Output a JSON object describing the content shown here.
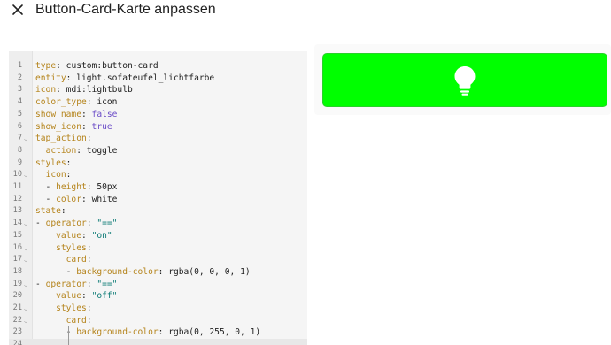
{
  "header": {
    "close_icon": "close-icon",
    "title": "Button-Card-Karte anpassen"
  },
  "editor": {
    "active_line": 24,
    "lines": [
      {
        "n": "1",
        "fold": false,
        "indent": 0,
        "key": "type",
        "sep": ": ",
        "value": "custom:button-card",
        "vtype": "plain"
      },
      {
        "n": "2",
        "fold": false,
        "indent": 0,
        "key": "entity",
        "sep": ": ",
        "value": "light.sofateufel_lichtfarbe",
        "vtype": "plain"
      },
      {
        "n": "3",
        "fold": false,
        "indent": 0,
        "key": "icon",
        "sep": ": ",
        "value": "mdi:lightbulb",
        "vtype": "plain"
      },
      {
        "n": "4",
        "fold": false,
        "indent": 0,
        "key": "color_type",
        "sep": ": ",
        "value": "icon",
        "vtype": "plain"
      },
      {
        "n": "5",
        "fold": false,
        "indent": 0,
        "key": "show_name",
        "sep": ": ",
        "value": "false",
        "vtype": "bool"
      },
      {
        "n": "6",
        "fold": false,
        "indent": 0,
        "key": "show_icon",
        "sep": ": ",
        "value": "true",
        "vtype": "bool"
      },
      {
        "n": "7",
        "fold": true,
        "indent": 0,
        "key": "tap_action",
        "sep": ":",
        "value": "",
        "vtype": "plain"
      },
      {
        "n": "8",
        "fold": false,
        "indent": 1,
        "key": "action",
        "sep": ": ",
        "value": "toggle",
        "vtype": "plain"
      },
      {
        "n": "9",
        "fold": false,
        "indent": 0,
        "key": "styles",
        "sep": ":",
        "value": "",
        "vtype": "plain"
      },
      {
        "n": "10",
        "fold": true,
        "indent": 1,
        "key": "icon",
        "sep": ":",
        "value": "",
        "vtype": "plain"
      },
      {
        "n": "11",
        "fold": false,
        "indent": 2,
        "dash": true,
        "key": "height",
        "sep": ": ",
        "value": "50px",
        "vtype": "plain"
      },
      {
        "n": "12",
        "fold": false,
        "indent": 2,
        "dash": true,
        "key": "color",
        "sep": ": ",
        "value": "white",
        "vtype": "plain"
      },
      {
        "n": "13",
        "fold": false,
        "indent": 0,
        "key": "state",
        "sep": ":",
        "value": "",
        "vtype": "plain"
      },
      {
        "n": "14",
        "fold": true,
        "indent": 1,
        "dash": true,
        "key": "operator",
        "sep": ": ",
        "value": "\"==\"",
        "vtype": "str"
      },
      {
        "n": "15",
        "fold": false,
        "indent": 2,
        "key": "value",
        "sep": ": ",
        "value": "\"on\"",
        "vtype": "str"
      },
      {
        "n": "16",
        "fold": true,
        "indent": 2,
        "key": "styles",
        "sep": ":",
        "value": "",
        "vtype": "plain"
      },
      {
        "n": "17",
        "fold": true,
        "indent": 3,
        "key": "card",
        "sep": ":",
        "value": "",
        "vtype": "plain"
      },
      {
        "n": "18",
        "fold": false,
        "indent": 4,
        "dash": true,
        "key": "background-color",
        "sep": ": ",
        "value": "rgba(0, 0, 0, 1)",
        "vtype": "plain"
      },
      {
        "n": "19",
        "fold": true,
        "indent": 1,
        "dash": true,
        "key": "operator",
        "sep": ": ",
        "value": "\"==\"",
        "vtype": "str"
      },
      {
        "n": "20",
        "fold": false,
        "indent": 2,
        "key": "value",
        "sep": ": ",
        "value": "\"off\"",
        "vtype": "str"
      },
      {
        "n": "21",
        "fold": true,
        "indent": 2,
        "key": "styles",
        "sep": ":",
        "value": "",
        "vtype": "plain"
      },
      {
        "n": "22",
        "fold": true,
        "indent": 3,
        "key": "card",
        "sep": ":",
        "value": "",
        "vtype": "plain"
      },
      {
        "n": "23",
        "fold": false,
        "indent": 4,
        "dash": true,
        "key": "background-color",
        "sep": ": ",
        "value": "rgba(0, 255, 0, 1)",
        "vtype": "plain"
      },
      {
        "n": "24",
        "fold": false,
        "indent": 0,
        "key": "",
        "sep": "",
        "value": "",
        "vtype": "plain"
      }
    ]
  },
  "preview": {
    "button_color": "#00ff00",
    "icon": "lightbulb-icon",
    "icon_color": "#ffffff"
  }
}
